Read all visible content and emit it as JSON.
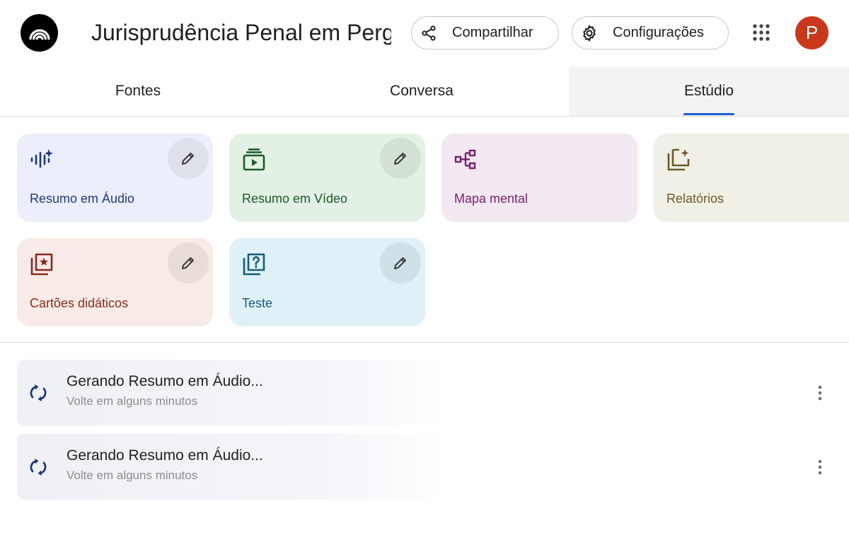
{
  "header": {
    "title": "Jurisprudência Penal em Perg",
    "share_label": "Compartilhar",
    "settings_label": "Configurações",
    "avatar_letter": "P",
    "avatar_color": "#c8381b"
  },
  "tabs": [
    {
      "label": "Fontes",
      "active": false
    },
    {
      "label": "Conversa",
      "active": false
    },
    {
      "label": "Estúdio",
      "active": true
    }
  ],
  "studio_tiles": [
    {
      "label": "Resumo em Áudio",
      "icon": "audio-waveform-icon",
      "bg": "#eceefb",
      "fg": "#1f3a78",
      "editable": true
    },
    {
      "label": "Resumo em Vídeo",
      "icon": "video-play-icon",
      "bg": "#e2f1e3",
      "fg": "#1e5a2a",
      "editable": true
    },
    {
      "label": "Mapa mental",
      "icon": "mind-map-icon",
      "bg": "#f1e8f1",
      "fg": "#7a1f6e",
      "editable": false
    },
    {
      "label": "Relatórios",
      "icon": "reports-icon",
      "bg": "#f1f0e6",
      "fg": "#6b5a2a",
      "editable": false
    },
    {
      "label": "Cartões didáticos",
      "icon": "flashcards-icon",
      "bg": "#f8ebe7",
      "fg": "#8a2a1e",
      "editable": true
    },
    {
      "label": "Teste",
      "icon": "quiz-icon",
      "bg": "#dff1f6",
      "fg": "#155e7a",
      "editable": true
    }
  ],
  "generating": [
    {
      "title": "Gerando Resumo em Áudio...",
      "subtitle": "Volte em alguns minutos"
    },
    {
      "title": "Gerando Resumo em Áudio...",
      "subtitle": "Volte em alguns minutos"
    }
  ]
}
